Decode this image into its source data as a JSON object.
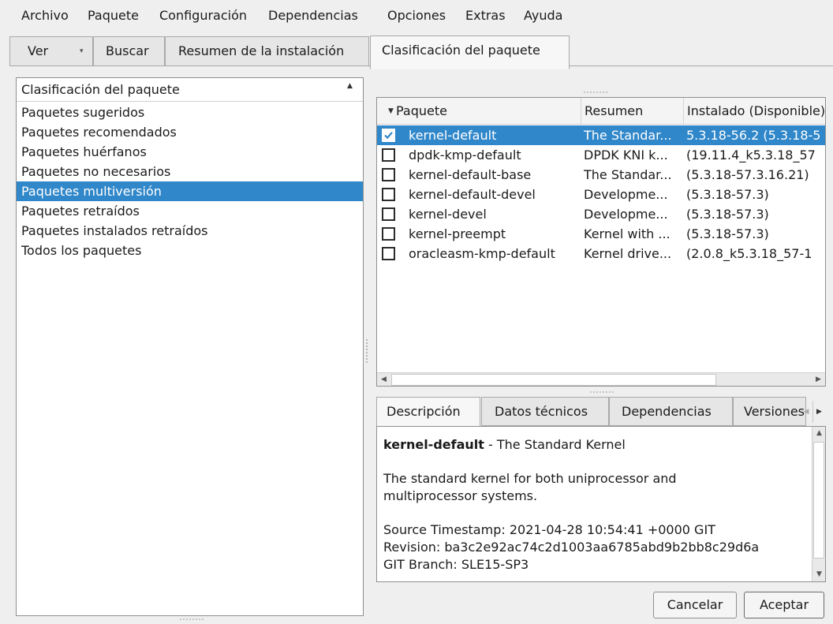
{
  "menubar": {
    "items": [
      "Archivo",
      "Paquete",
      "Configuración",
      "Dependencias",
      "Opciones",
      "Extras",
      "Ayuda"
    ]
  },
  "top_tabs": {
    "ver": "Ver",
    "buscar": "Buscar",
    "resumen": "Resumen de la instalación",
    "clasificacion": "Clasificación del paquete"
  },
  "left_panel": {
    "header": "Clasificación del paquete",
    "items": [
      "Paquetes sugeridos",
      "Paquetes recomendados",
      "Paquetes huérfanos",
      "Paquetes no necesarios",
      "Paquetes multiversión",
      "Paquetes retraídos",
      "Paquetes instalados retraídos",
      "Todos los paquetes"
    ],
    "selected_index": 4
  },
  "package_list": {
    "columns": [
      "Paquete",
      "Resumen",
      "Instalado (Disponible)"
    ],
    "rows": [
      {
        "checked": true,
        "name": "kernel-default",
        "summary": "The Standar...",
        "version": "5.3.18-56.2 (5.3.18-5"
      },
      {
        "checked": false,
        "name": "dpdk-kmp-default",
        "summary": "DPDK KNI k...",
        "version": "(19.11.4_k5.3.18_57"
      },
      {
        "checked": false,
        "name": "kernel-default-base",
        "summary": "The Standar...",
        "version": "(5.3.18-57.3.16.21)"
      },
      {
        "checked": false,
        "name": "kernel-default-devel",
        "summary": "Developme...",
        "version": "(5.3.18-57.3)"
      },
      {
        "checked": false,
        "name": "kernel-devel",
        "summary": "Developme...",
        "version": "(5.3.18-57.3)"
      },
      {
        "checked": false,
        "name": "kernel-preempt",
        "summary": "Kernel with ...",
        "version": "(5.3.18-57.3)"
      },
      {
        "checked": false,
        "name": "oracleasm-kmp-default",
        "summary": "Kernel drive...",
        "version": "(2.0.8_k5.3.18_57-1"
      }
    ],
    "selected_index": 0
  },
  "detail_tabs": {
    "descripcion": "Descripción",
    "datos": "Datos técnicos",
    "dependencias": "Dependencias",
    "versiones": "Versiones"
  },
  "detail": {
    "pkg_name": "kernel-default",
    "pkg_sep": " - ",
    "pkg_title": "The Standard Kernel",
    "line1": "The standard kernel for both uniprocessor and",
    "line2": "multiprocessor systems.",
    "line3": "Source Timestamp: 2021-04-28 10:54:41 +0000 GIT",
    "line4": "Revision: ba3c2e92ac74c2d1003aa6785abd9b2bb8c29d6a",
    "line5": "GIT Branch: SLE15-SP3"
  },
  "buttons": {
    "cancel": "Cancelar",
    "accept": "Aceptar"
  },
  "colors": {
    "selection": "#3087c9",
    "window_bg": "#efefef"
  }
}
